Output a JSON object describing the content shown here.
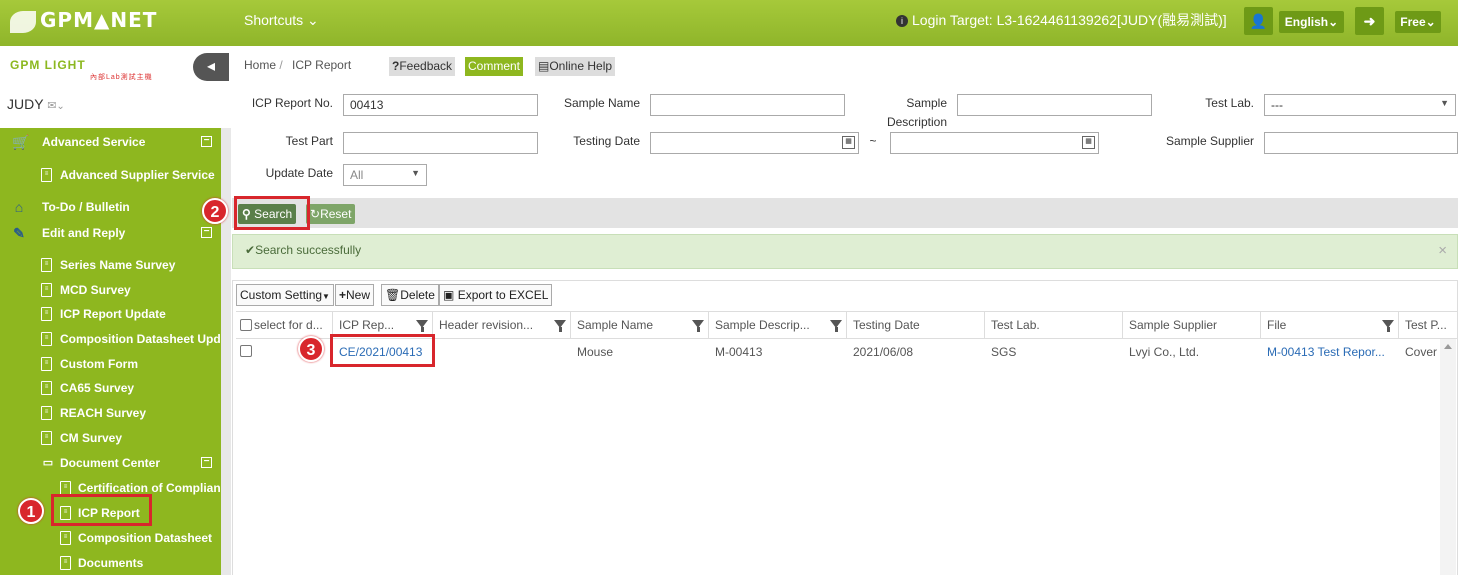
{
  "topbar": {
    "logo": "GPM▲NET",
    "shortcuts": "Shortcuts",
    "login_label": "Login Target:",
    "login_value": "L3-1624461139262[JUDY(融易測試)]",
    "language": "English",
    "plan": "Free",
    "accent": "#8fb52a"
  },
  "sidebar": {
    "logo": "GPM LIGHT",
    "logo_sub": "內部Lab測試主機",
    "user": "JUDY",
    "items": [
      {
        "label": "Advanced Service",
        "icon": "cart-icon",
        "level": 0,
        "toggle": "−"
      },
      {
        "label": "Advanced Supplier Service",
        "icon": "document-icon",
        "level": 1
      },
      {
        "label": "To-Do / Bulletin",
        "icon": "home-icon",
        "level": 0
      },
      {
        "label": "Edit and Reply",
        "icon": "edit-icon",
        "level": 0,
        "toggle": "−"
      },
      {
        "label": "Series Name Survey",
        "icon": "document-icon",
        "level": 1
      },
      {
        "label": "MCD Survey",
        "icon": "document-icon",
        "level": 1
      },
      {
        "label": "ICP Report Update",
        "icon": "document-icon",
        "level": 1
      },
      {
        "label": "Composition Datasheet Update",
        "icon": "document-icon",
        "level": 1
      },
      {
        "label": "Custom Form",
        "icon": "document-icon",
        "level": 1
      },
      {
        "label": "CA65 Survey",
        "icon": "document-icon",
        "level": 1
      },
      {
        "label": "REACH Survey",
        "icon": "document-icon",
        "level": 1
      },
      {
        "label": "CM Survey",
        "icon": "document-icon",
        "level": 1
      },
      {
        "label": "Document Center",
        "icon": "folder-icon",
        "level": 1,
        "toggle": "−"
      },
      {
        "label": "Certification of Compliance",
        "icon": "document-icon",
        "level": 2
      },
      {
        "label": "ICP Report",
        "icon": "document-icon",
        "level": 2
      },
      {
        "label": "Composition Datasheet",
        "icon": "document-icon",
        "level": 2
      },
      {
        "label": "Documents",
        "icon": "document-icon",
        "level": 2
      }
    ]
  },
  "header": {
    "breadcrumb_home": "Home",
    "breadcrumb_sep": "/",
    "breadcrumb_current": "ICP Report",
    "feedback": "Feedback",
    "comment": "Comment",
    "online_help": "Online Help"
  },
  "form": {
    "icp_report_no_label": "ICP Report No.",
    "icp_report_no_value": "00413",
    "sample_name_label": "Sample Name",
    "sample_description_label_1": "Sample",
    "sample_description_label_2": "Description",
    "test_lab_label": "Test Lab.",
    "test_lab_value": "---",
    "test_part_label": "Test Part",
    "testing_date_label": "Testing Date",
    "date_separator": "~",
    "sample_supplier_label": "Sample Supplier",
    "update_date_label": "Update Date",
    "update_date_value": "All"
  },
  "actions": {
    "search": "Search",
    "reset": "Reset"
  },
  "message": {
    "text": "Search successfully",
    "close": "×"
  },
  "grid": {
    "toolbar": {
      "custom_setting": "Custom Setting",
      "new": "New",
      "delete": "Delete",
      "export": "Export to EXCEL"
    },
    "columns": [
      "select for d...",
      "ICP Rep...",
      "Header revision...",
      "Sample Name",
      "Sample Descrip...",
      "Testing Date",
      "Test Lab.",
      "Sample Supplier",
      "File",
      "Test P..."
    ],
    "rows": [
      {
        "icp_report": "CE/2021/00413",
        "header_revision": "",
        "sample_name": "Mouse",
        "sample_description": "M-00413",
        "testing_date": "2021/06/08",
        "test_lab": "SGS",
        "sample_supplier": "Lvyi Co., Ltd.",
        "file": "M-00413 Test Repor...",
        "test_part": "Cover"
      }
    ]
  },
  "annotations": {
    "step1": "1",
    "step2": "2",
    "step3": "3",
    "color": "#d8262c"
  }
}
